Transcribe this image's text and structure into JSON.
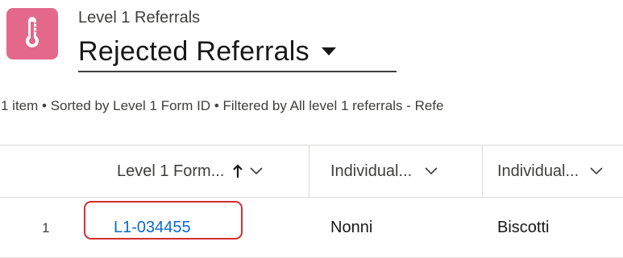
{
  "header": {
    "icon": "thermometer-icon",
    "icon_bg": "#e3688c",
    "object_label": "Level 1 Referrals",
    "list_title": "Rejected Referrals"
  },
  "list_meta": "1 item • Sorted by Level 1 Form ID • Filtered by All level 1 referrals - Refe",
  "table": {
    "columns": [
      {
        "label": "Level 1 Form...",
        "sorted": "ascending"
      },
      {
        "label": "Individual..."
      },
      {
        "label": "Individual..."
      }
    ],
    "rows": [
      {
        "num": "1",
        "cells": [
          "L1-034455",
          "Nonni",
          "Biscotti"
        ]
      }
    ]
  },
  "colors": {
    "link": "#0b6bcb",
    "highlight": "#d32f2f"
  }
}
